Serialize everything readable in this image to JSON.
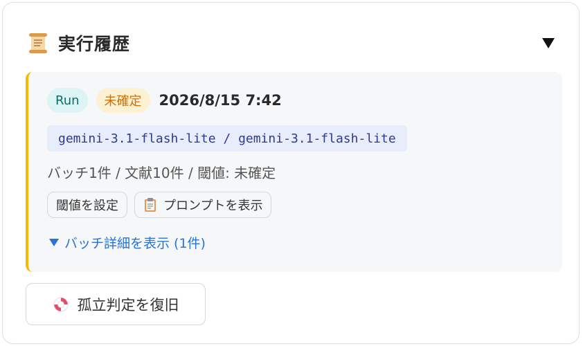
{
  "header": {
    "title": "実行履歴",
    "icon": "scroll-icon",
    "toggle_icon": "collapse-triangle-icon"
  },
  "run": {
    "type_badge": "Run",
    "status_badge": "未確定",
    "datetime": "2026/8/15 7:42",
    "models": "gemini-3.1-flash-lite / gemini-3.1-flash-lite",
    "summary": "バッチ1件 / 文献10件 / 閾値: 未確定",
    "accent_color": "#f5b800",
    "set_threshold_label": "閾値を設定",
    "show_prompt_label": "プロンプトを表示",
    "show_prompt_icon": "clipboard-icon",
    "batch_details_label": "バッチ詳細を表示 (1件)"
  },
  "restore": {
    "label": "孤立判定を復旧",
    "icon": "lifebuoy-icon"
  }
}
